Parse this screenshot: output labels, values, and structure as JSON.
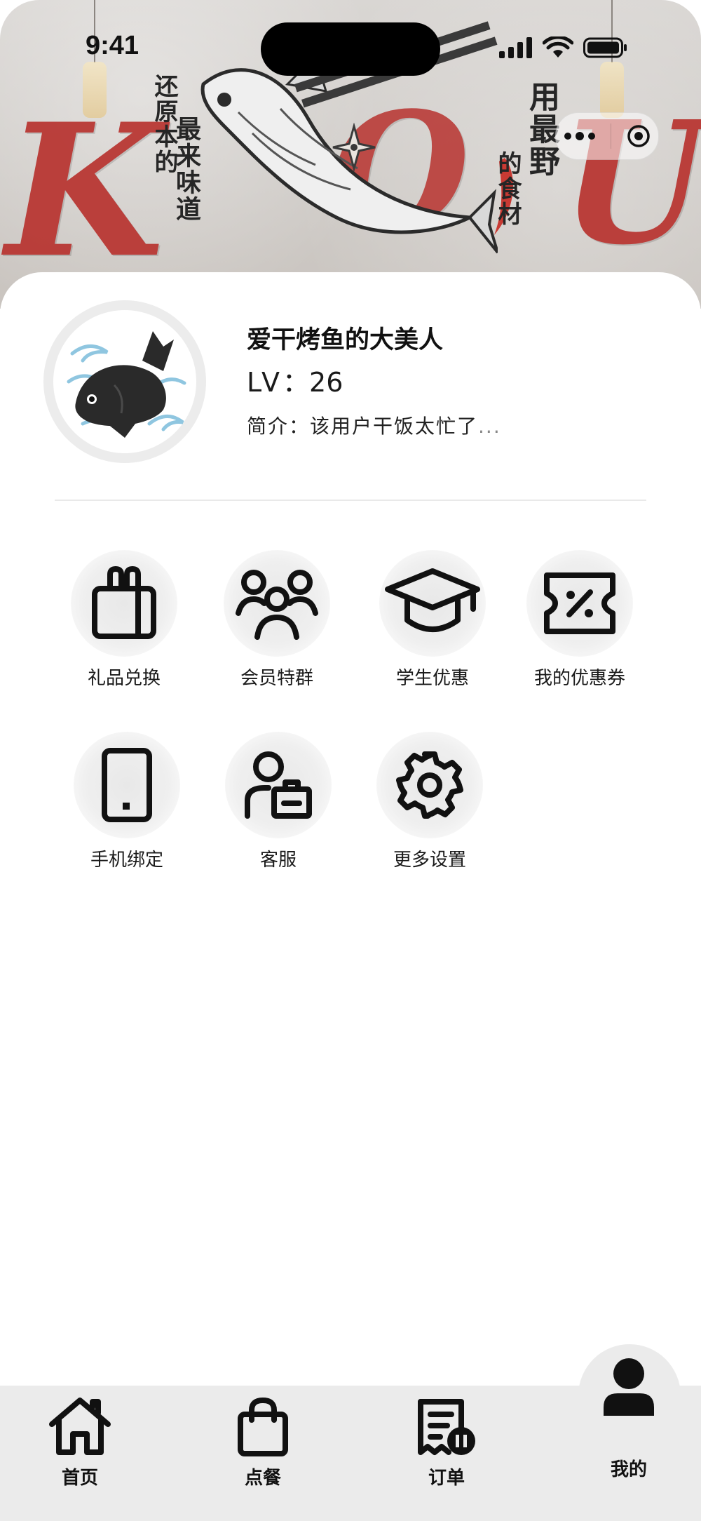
{
  "status_bar": {
    "time": "9:41"
  },
  "hero": {
    "left_calligraphy_col1": "还原本的",
    "left_calligraphy_col2": "最来味道",
    "right_calligraphy_col1": "用最野",
    "right_calligraphy_col2": "的食材"
  },
  "profile": {
    "username": "爱干烤鱼的大美人",
    "level_prefix": "LV",
    "level_sep": "：",
    "level_value": "26",
    "bio_label": "简介：",
    "bio_text": "该用户干饭太忙了",
    "bio_ellipsis": "..."
  },
  "menu": {
    "items": [
      {
        "label": "礼品兑换",
        "icon": "gift-bag-icon"
      },
      {
        "label": "会员特群",
        "icon": "group-icon"
      },
      {
        "label": "学生优惠",
        "icon": "graduation-cap-icon"
      },
      {
        "label": "我的优惠券",
        "icon": "coupon-icon"
      },
      {
        "label": "手机绑定",
        "icon": "phone-icon"
      },
      {
        "label": "客服",
        "icon": "customer-service-icon"
      },
      {
        "label": "更多设置",
        "icon": "gear-icon"
      }
    ]
  },
  "tabbar": {
    "items": [
      {
        "label": "首页",
        "icon": "home-icon"
      },
      {
        "label": "点餐",
        "icon": "shopping-bag-icon"
      },
      {
        "label": "订单",
        "icon": "order-list-icon"
      },
      {
        "label": "我的",
        "icon": "user-icon",
        "active": true
      }
    ]
  },
  "colors": {
    "accent_red": "#b8332f",
    "tabbar_bg": "#ebebeb",
    "icon_color": "#111111"
  }
}
